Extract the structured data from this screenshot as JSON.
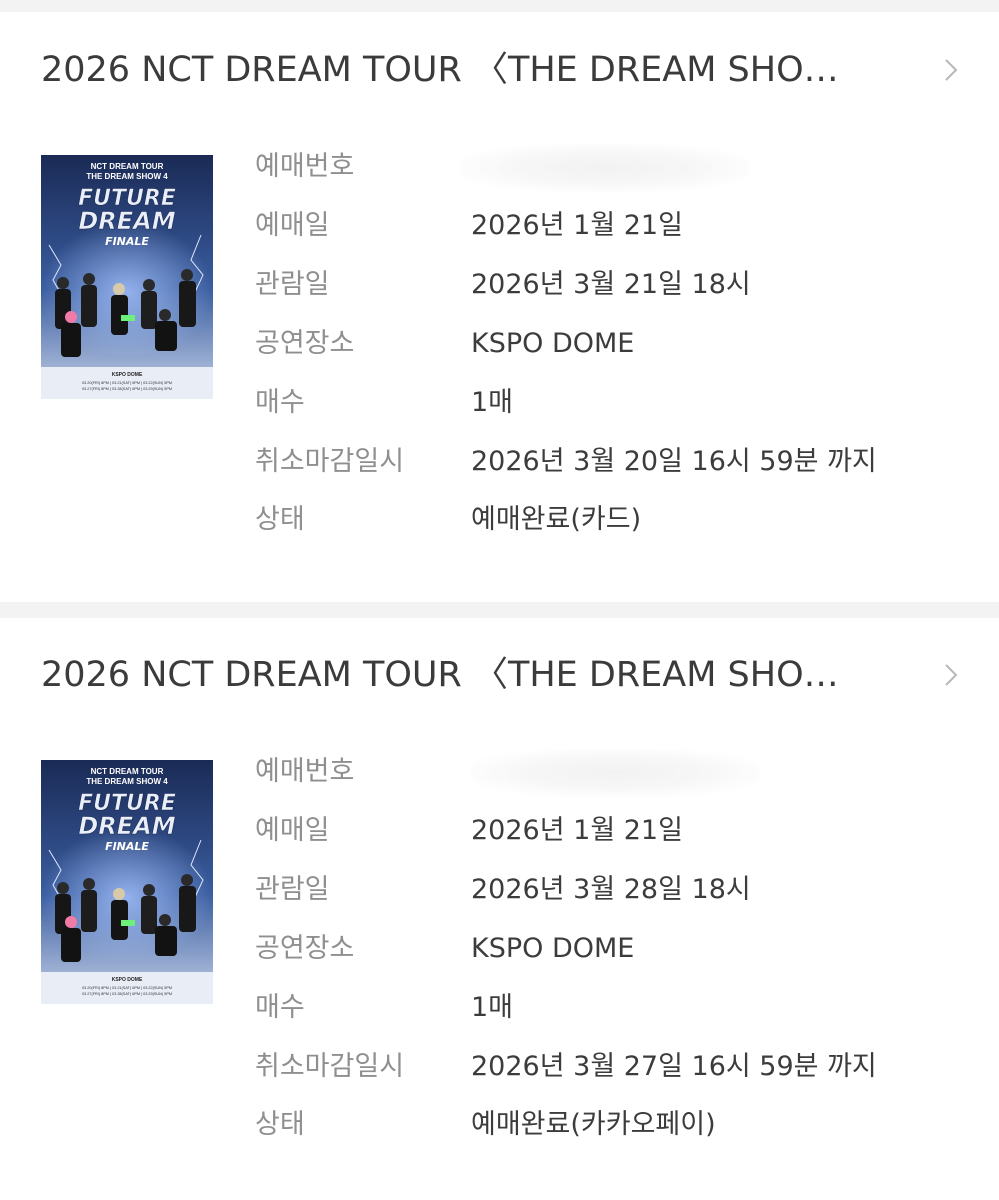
{
  "bookings": [
    {
      "title": "2026 NCT DREAM TOUR 〈THE DREAM SHO…",
      "poster": {
        "line1": "NCT DREAM TOUR",
        "line2": "THE DREAM SHOW 4",
        "logo_line1": "FUTURE",
        "logo_line2": "DREAM",
        "logo_line3": "FINALE",
        "venue": "KSPO DOME",
        "dates_line1": "03.20(FRI) 8PM | 03.21(SAT) 6PM | 03.22(SUN) 5PM",
        "dates_line2": "03.27(FRI) 8PM | 03.28(SAT) 6PM | 03.29(SUN) 5PM"
      },
      "fields": [
        {
          "label": "예매번호",
          "value": ""
        },
        {
          "label": "예매일",
          "value": "2026년 1월 21일"
        },
        {
          "label": "관람일",
          "value": "2026년 3월 21일 18시"
        },
        {
          "label": "공연장소",
          "value": "KSPO DOME"
        },
        {
          "label": "매수",
          "value": "1매"
        },
        {
          "label": "취소마감일시",
          "value": "2026년 3월 20일 16시 59분 까지"
        },
        {
          "label": "상태",
          "value": "예매완료(카드)"
        }
      ]
    },
    {
      "title": "2026 NCT DREAM TOUR 〈THE DREAM SHO…",
      "poster": {
        "line1": "NCT DREAM TOUR",
        "line2": "THE DREAM SHOW 4",
        "logo_line1": "FUTURE",
        "logo_line2": "DREAM",
        "logo_line3": "FINALE",
        "venue": "KSPO DOME",
        "dates_line1": "03.20(FRI) 8PM | 03.21(SAT) 6PM | 03.22(SUN) 5PM",
        "dates_line2": "03.27(FRI) 8PM | 03.28(SAT) 6PM | 03.29(SUN) 5PM"
      },
      "fields": [
        {
          "label": "예매번호",
          "value": ""
        },
        {
          "label": "예매일",
          "value": "2026년 1월 21일"
        },
        {
          "label": "관람일",
          "value": "2026년 3월 28일 18시"
        },
        {
          "label": "공연장소",
          "value": "KSPO DOME"
        },
        {
          "label": "매수",
          "value": "1매"
        },
        {
          "label": "취소마감일시",
          "value": "2026년 3월 27일 16시 59분 까지"
        },
        {
          "label": "상태",
          "value": "예매완료(카카오페이)"
        }
      ]
    }
  ],
  "colors": {
    "title_text": "#3b3b3b",
    "label_text": "#8f8f8f",
    "value_text": "#3c3c3c",
    "separator": "#f3f3f3",
    "chevron": "#b8b8b8"
  },
  "icons": {
    "chevron": "chevron-right-icon"
  }
}
